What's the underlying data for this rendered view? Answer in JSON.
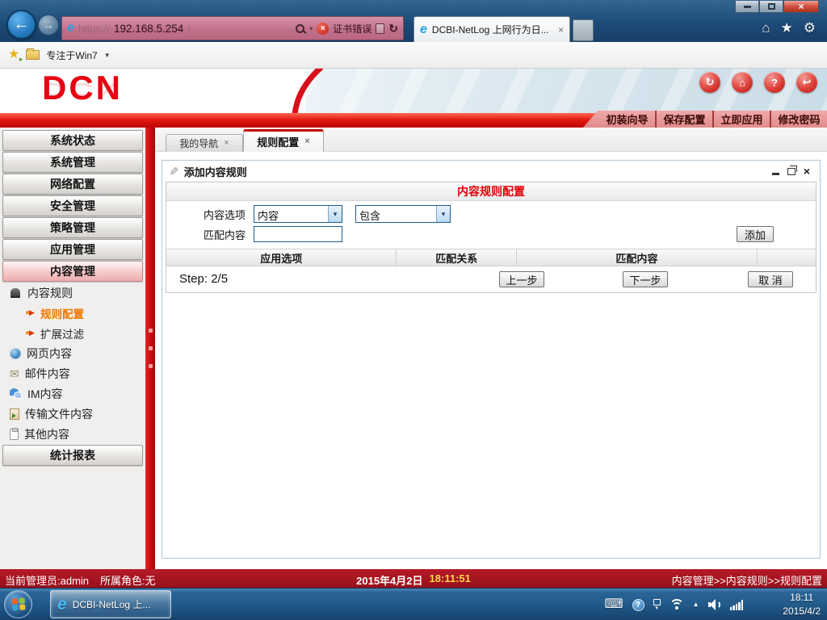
{
  "icons": {
    "close": "×",
    "back_arrow": "←",
    "forward_arrow": "→",
    "home": "⌂",
    "star": "★",
    "gear": "⚙",
    "refresh": "↻",
    "help": "?",
    "logout": "↩",
    "pencil": "✎",
    "mail": "✉",
    "keyboard": "⌨",
    "chevron_down": "▾",
    "tray_expand": "▲",
    "bullet_dot": "●",
    "bullet_arrow": "▶",
    "ie_logo": "e",
    "fav_add_arrow": "▸",
    "folder_caret": "▼"
  },
  "browser": {
    "url": {
      "scheme": "https://",
      "host": "192.168.5.254",
      "path": "/"
    },
    "cert_error": "证书错误",
    "tab_title": "DCBI-NetLog 上网行为日...",
    "favorites_bar": {
      "folder_label": "专注于Win7"
    }
  },
  "header": {
    "logo_text": "DCN",
    "quick_buttons": [
      "初装向导",
      "保存配置",
      "立即应用",
      "修改密码"
    ]
  },
  "sidebar": {
    "main_items": [
      "系统状态",
      "系统管理",
      "网络配置",
      "安全管理",
      "策略管理",
      "应用管理",
      "内容管理"
    ],
    "tree": {
      "group_label": "内容规则",
      "children": [
        "规则配置",
        "扩展过滤"
      ],
      "section_items": [
        "网页内容",
        "邮件内容",
        "IM内容",
        "传输文件内容",
        "其他内容"
      ]
    },
    "report_item": "统计报表"
  },
  "content": {
    "tabs": [
      "我的导航",
      "规则配置"
    ],
    "dialog": {
      "title": "添加内容规则",
      "panel_title": "内容规则配置",
      "content_option_label": "内容选项",
      "content_option_value": "内容",
      "match_relation_value": "包含",
      "match_content_label": "匹配内容",
      "match_content_value": "",
      "add_button": "添加",
      "table_headers": [
        "应用选项",
        "匹配关系",
        "匹配内容"
      ],
      "step_label": "Step: 2/5",
      "prev_button": "上一步",
      "next_button": "下一步",
      "cancel_button": "取 消"
    }
  },
  "statusbar": {
    "admin_text": "当前管理员:admin",
    "role_text": "所属角色:无",
    "date_text": "2015年4月2日",
    "time_text": "18:11:51",
    "breadcrumb": "内容管理>>内容规则>>规则配置"
  },
  "taskbar": {
    "ie_button_label": "DCBI-NetLog 上...",
    "clock_time": "18:11",
    "clock_date": "2015/4/2"
  }
}
